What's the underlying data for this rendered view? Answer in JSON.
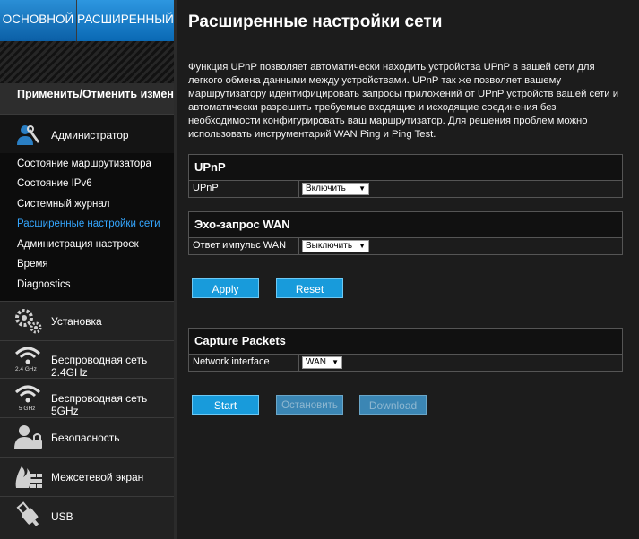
{
  "tabs": {
    "basic": "ОСНОВНОЙ",
    "advanced": "РАСШИРЕННЫЙ"
  },
  "sidebar": {
    "apply_changes": "Применить/Отменить изменения",
    "admin_label": "Администратор",
    "admin_items": [
      "Состояние маршрутизатора",
      "Состояние IPv6",
      "Системный журнал",
      "Расширенные настройки сети",
      "Администрация настроек",
      "Время",
      "Diagnostics"
    ],
    "selected_item": "Расширенные настройки сети",
    "sections": {
      "setup": "Установка",
      "wifi24": "Беспроводная сеть 2.4GHz",
      "wifi24_badge": "2.4 GHz",
      "wifi5": "Беспроводная сеть 5GHz",
      "wifi5_badge": "5 GHz",
      "security": "Безопасность",
      "firewall": "Межсетевой экран",
      "usb": "USB"
    }
  },
  "main": {
    "title": "Расширенные настройки сети",
    "description": "Функция UPnP позволяет автоматически находить устройства UPnP в вашей сети для легкого обмена данными между устройствами. UPnP так же позволяет вашему маршрутизатору идентифицировать запросы приложений от UPnP устройств вашей сети и автоматически разрешить требуемые входящие и исходящие соединения без необходимости конфигурировать ваш маршрутизатор. Для решения проблем можно использовать инструментарий WAN Ping и Ping Test.",
    "upnp": {
      "header": "UPnP",
      "label": "UPnP",
      "value": "Включить"
    },
    "wan_ping": {
      "header": "Эхо-запрос WAN",
      "label": "Ответ импульс WAN",
      "value": "Выключить"
    },
    "apply_label": "Apply",
    "reset_label": "Reset",
    "capture": {
      "header": "Capture Packets",
      "label": "Network interface",
      "value": "WAN"
    },
    "start_label": "Start",
    "stop_label": "Остановить",
    "download_label": "Download"
  },
  "colors": {
    "accent": "#189bdb",
    "tab_blue": "#0a69b4",
    "selected_link": "#35a7ff"
  }
}
